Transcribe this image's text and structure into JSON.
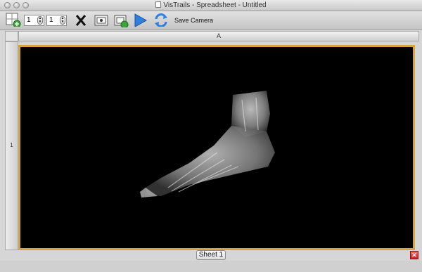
{
  "window": {
    "title": "VisTrails - Spreadsheet - Untitled"
  },
  "toolbar": {
    "rows_value": "1",
    "cols_value": "1",
    "save_camera_label": "Save Camera"
  },
  "sheet": {
    "column_header": "A",
    "row_header": "1",
    "tab_label": "Sheet 1"
  },
  "colors": {
    "selected_cell_border": "#d6a63c",
    "cell_background": "#000000",
    "close_sheet": "#e02020"
  },
  "icons": [
    "add-sheet-icon",
    "delete-cell-icon",
    "camera-icon",
    "camera-capture-icon",
    "play-icon",
    "sync-icon",
    "close-sheet-icon"
  ]
}
